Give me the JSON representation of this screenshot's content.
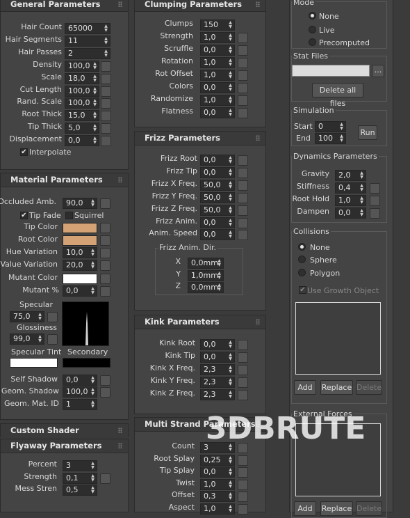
{
  "general": {
    "title": "General Parameters",
    "rows": [
      {
        "label": "Hair Count",
        "value": "65000"
      },
      {
        "label": "Hair Segments",
        "value": "11"
      },
      {
        "label": "Hair Passes",
        "value": "2"
      },
      {
        "label": "Density",
        "value": "100,0"
      },
      {
        "label": "Scale",
        "value": "18,0"
      },
      {
        "label": "Cut Length",
        "value": "100,0"
      },
      {
        "label": "Rand. Scale",
        "value": "100,0"
      },
      {
        "label": "Root Thick",
        "value": "15,0"
      },
      {
        "label": "Tip Thick",
        "value": "5,0"
      },
      {
        "label": "Displacement",
        "value": "0,0"
      }
    ],
    "interpolate": "Interpolate"
  },
  "material": {
    "title": "Material Parameters",
    "occluded_label": "Occluded Amb.",
    "occluded_value": "90,0",
    "tip_fade": "Tip Fade",
    "squirrel": "Squirrel",
    "tip_color": "Tip Color",
    "root_color": "Root Color",
    "hue_label": "Hue Variation",
    "hue_value": "10,0",
    "value_label": "Value Variation",
    "value_value": "20,0",
    "mutant_color": "Mutant Color",
    "mutant_pct_label": "Mutant %",
    "mutant_pct_value": "0,0",
    "specular_label": "Specular",
    "specular_value": "75,0",
    "gloss_label": "Glossiness",
    "gloss_value": "99,0",
    "spec_tint": "Specular Tint",
    "secondary": "Secondary",
    "self_shadow_label": "Self Shadow",
    "self_shadow_value": "0,0",
    "geom_shadow_label": "Geom. Shadow",
    "geom_shadow_value": "100,0",
    "geom_mat_label": "Geom. Mat. ID",
    "geom_mat_value": "1",
    "colors": {
      "tip": "#d4a274",
      "root": "#d4a274",
      "mutant": "#ffffff",
      "spec_tint": "#ffffff",
      "secondary": "#000000"
    }
  },
  "custom_shader": {
    "title": "Custom Shader"
  },
  "flyaway": {
    "title": "Flyaway Parameters",
    "rows": [
      {
        "label": "Percent",
        "value": "3"
      },
      {
        "label": "Strength",
        "value": "0,1"
      },
      {
        "label": "Mess Stren",
        "value": "0,5"
      }
    ]
  },
  "clumping": {
    "title": "Clumping Parameters",
    "rows": [
      {
        "label": "Clumps",
        "value": "150"
      },
      {
        "label": "Strength",
        "value": "1,0"
      },
      {
        "label": "Scruffle",
        "value": "0,0"
      },
      {
        "label": "Rotation",
        "value": "1,0"
      },
      {
        "label": "Rot Offset",
        "value": "1,0"
      },
      {
        "label": "Colors",
        "value": "0,0"
      },
      {
        "label": "Randomize",
        "value": "1,0"
      },
      {
        "label": "Flatness",
        "value": "0,0"
      }
    ]
  },
  "frizz": {
    "title": "Frizz Parameters",
    "rows": [
      {
        "label": "Frizz Root",
        "value": "0,0"
      },
      {
        "label": "Frizz Tip",
        "value": "0,0"
      },
      {
        "label": "Frizz X Freq.",
        "value": "50,0"
      },
      {
        "label": "Frizz Y Freq.",
        "value": "50,0"
      },
      {
        "label": "Frizz Z Freq.",
        "value": "50,0"
      },
      {
        "label": "Frizz Anim.",
        "value": "0,0"
      },
      {
        "label": "Anim. Speed",
        "value": "0,0"
      }
    ],
    "dir_title": "Frizz Anim. Dir.",
    "dir": [
      {
        "label": "X",
        "value": "0,0mm"
      },
      {
        "label": "Y",
        "value": "1,0mm"
      },
      {
        "label": "Z",
        "value": "0,0mm"
      }
    ]
  },
  "kink": {
    "title": "Kink Parameters",
    "rows": [
      {
        "label": "Kink Root",
        "value": "0,0"
      },
      {
        "label": "Kink Tip",
        "value": "0,0"
      },
      {
        "label": "Kink X Freq.",
        "value": "2,3"
      },
      {
        "label": "Kink Y Freq.",
        "value": "2,3"
      },
      {
        "label": "Kink Z Freq.",
        "value": "2,3"
      }
    ]
  },
  "multi_strand": {
    "title": "Multi Strand Parameters",
    "rows": [
      {
        "label": "Count",
        "value": "3"
      },
      {
        "label": "Root Splay",
        "value": "0,25"
      },
      {
        "label": "Tip Splay",
        "value": "0,0"
      },
      {
        "label": "Twist",
        "value": "1,0"
      },
      {
        "label": "Offset",
        "value": "0,3"
      },
      {
        "label": "Aspect",
        "value": "1,0"
      }
    ]
  },
  "dynamics": {
    "mode_title": "Mode",
    "modes": [
      "None",
      "Live",
      "Precomputed"
    ],
    "stat_title": "Stat Files",
    "browse": "...",
    "delete_all": "Delete all files",
    "sim_title": "Simulation",
    "start_label": "Start",
    "start_value": "0",
    "end_label": "End",
    "end_value": "100",
    "run": "Run",
    "dyn_title": "Dynamics Parameters",
    "rows": [
      {
        "label": "Gravity",
        "value": "2,0"
      },
      {
        "label": "Stiffness",
        "value": "0,4"
      },
      {
        "label": "Root Hold",
        "value": "1,0"
      },
      {
        "label": "Dampen",
        "value": "0,0"
      }
    ],
    "coll_title": "Collisions",
    "collisions": [
      "None",
      "Sphere",
      "Polygon"
    ],
    "use_growth": "Use Growth Object",
    "add": "Add",
    "replace": "Replace",
    "delete": "Delete",
    "ext_title": "External Forces"
  },
  "watermark": "3DBRUTE"
}
